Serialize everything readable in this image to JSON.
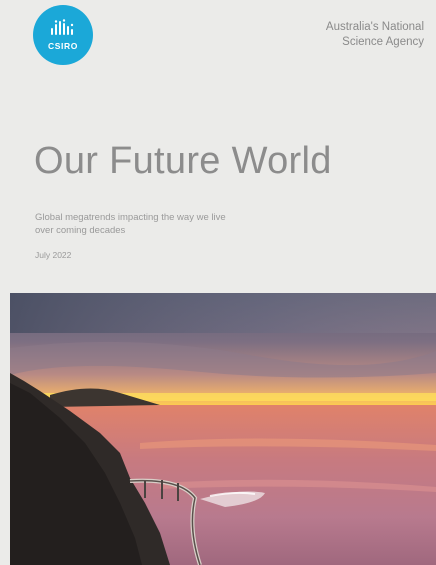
{
  "logo": {
    "text": "CSIRO",
    "icon": "csiro-emblem-icon",
    "color": "#1ba8d8"
  },
  "tagline": {
    "line1": "Australia's National",
    "line2": "Science Agency"
  },
  "title": "Our Future World",
  "subtitle": {
    "line1": "Global megatrends impacting the way we live",
    "line2": "over coming decades"
  },
  "date": "July 2022",
  "cover_image": {
    "subject": "sunset-over-coastal-cliff-road"
  }
}
